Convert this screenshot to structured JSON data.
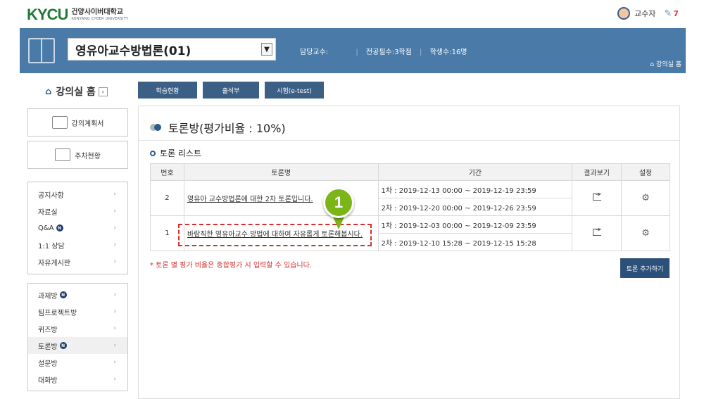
{
  "brand": {
    "logo_mark": "KYCU",
    "name_ko": "건양사이버대학교",
    "name_en": "KONYANG CYBER UNIVERSITY"
  },
  "user": {
    "role": "교수자",
    "notification_count": "7"
  },
  "course": {
    "title": "영유아교수방법론(01)",
    "professor_label": "담당교수:",
    "credits": "전공필수:3학점",
    "students": "학생수:16명",
    "room_link": "강의실 홈"
  },
  "sidebar": {
    "home": "강의실 홈",
    "plan_button": "강의계획서",
    "weekly_button": "주차현황",
    "menu1": [
      {
        "label": "공지사항",
        "new": false
      },
      {
        "label": "자료실",
        "new": false
      },
      {
        "label": "Q&A",
        "new": true
      },
      {
        "label": "1:1 상담",
        "new": false
      },
      {
        "label": "자유게시판",
        "new": false
      }
    ],
    "menu2": [
      {
        "label": "과제방",
        "new": true
      },
      {
        "label": "팀프로젝트방",
        "new": false
      },
      {
        "label": "퀴즈방",
        "new": false
      },
      {
        "label": "토론방",
        "new": true
      },
      {
        "label": "설문방",
        "new": false
      },
      {
        "label": "대화방",
        "new": false
      }
    ],
    "new_badge": "N",
    "chevron": "›"
  },
  "tabs": [
    "학습현황",
    "출석부",
    "시험(e-test)"
  ],
  "content": {
    "title": "토론방(평가비율 : 10%)",
    "subtitle": "토론 리스트",
    "headers": [
      "번호",
      "토론명",
      "기간",
      "결과보기",
      "설정"
    ],
    "rows": [
      {
        "no": "2",
        "name": "영유아 교수방법론에 대한 2차 토론입니다.",
        "period1": "1차 : 2019-12-13 00:00 ~ 2019-12-19 23:59",
        "period2": "2차 : 2019-12-20 00:00 ~ 2019-12-26 23:59"
      },
      {
        "no": "1",
        "name": "바람직한 영유아교수 방법에 대하여 자유롭게 토론해봅시다.",
        "period1": "1차 : 2019-12-03 00:00 ~ 2019-12-09 23:59",
        "period2": "2차 : 2019-12-10 15:28 ~ 2019-12-15 15:28"
      }
    ],
    "note": "* 토론 별 평가 비율은 종합평가 시 입력할 수 있습니다.",
    "add_button": "토론 추가하기",
    "settings_glyph": "⚙"
  },
  "callout": {
    "number": "1"
  },
  "colors": {
    "banner": "#4a7ba8",
    "tab": "#3c5f86",
    "accent": "#2b5d8c",
    "callout": "#7cb518",
    "highlight": "#d32f2f"
  }
}
